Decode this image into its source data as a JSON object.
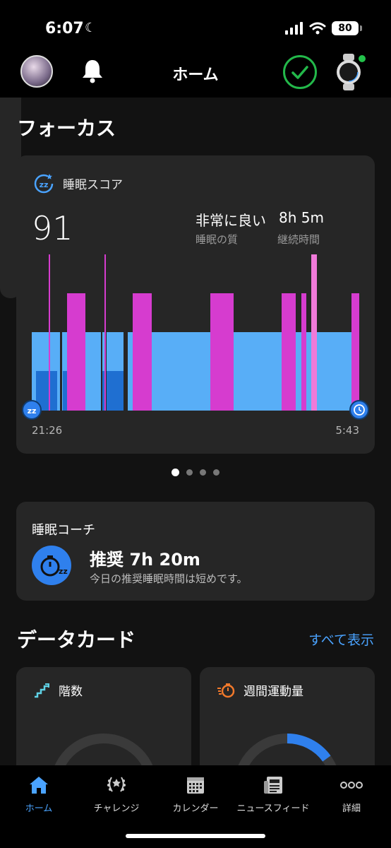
{
  "status_bar": {
    "time": "6:07",
    "battery": "80"
  },
  "header": {
    "title": "ホーム"
  },
  "focus": {
    "title": "フォーカス",
    "sleep_card": {
      "label": "睡眠スコア",
      "score": "91",
      "quality": "非常に良い",
      "quality_label": "睡眠の質",
      "duration": "8h 5m",
      "duration_label": "継続時間",
      "start_time": "21:26",
      "end_time": "5:43"
    },
    "pager": {
      "count": 4,
      "active": 0
    }
  },
  "sleep_coach": {
    "title": "睡眠コーチ",
    "recommendation": "推奨 7h 20m",
    "message": "今日の推奨睡眠時間は短めです。"
  },
  "data_cards": {
    "title": "データカード",
    "show_all": "すべて表示",
    "cards": [
      {
        "label": "階数",
        "icon": "stairs-icon"
      },
      {
        "label": "週間運動量",
        "icon": "stopwatch-icon",
        "progress": 0.15
      }
    ]
  },
  "bottom_nav": [
    {
      "label": "ホーム",
      "icon": "home-icon",
      "active": true
    },
    {
      "label": "チャレンジ",
      "icon": "laurel-icon",
      "active": false
    },
    {
      "label": "カレンダー",
      "icon": "calendar-icon",
      "active": false
    },
    {
      "label": "ニュースフィード",
      "icon": "newsfeed-icon",
      "active": false
    },
    {
      "label": "詳細",
      "icon": "more-icon",
      "active": false
    }
  ],
  "colors": {
    "accent": "#4aa3ff",
    "deep_sleep": "#1f6fd1",
    "light_sleep": "#58aef7",
    "rem_sleep": "#d63ccf",
    "awake": "#f07ad9",
    "check": "#23b84a"
  }
}
